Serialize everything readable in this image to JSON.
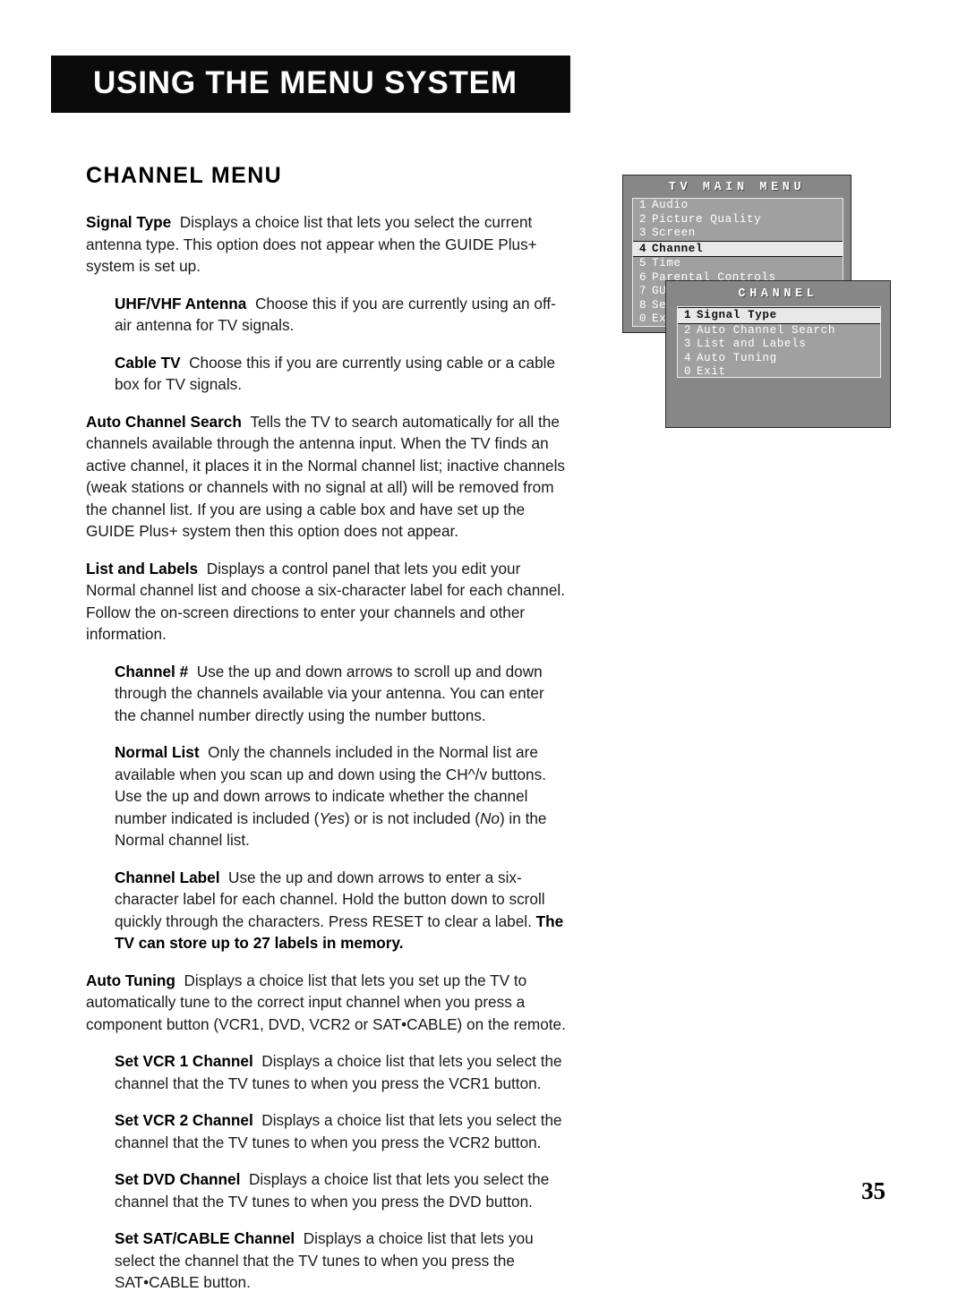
{
  "header": {
    "title": "USING THE MENU SYSTEM"
  },
  "section": {
    "title": "CHANNEL MENU"
  },
  "page_number": "35",
  "body": {
    "paragraphs": [
      {
        "indent": false,
        "term": "Signal Type",
        "text": "Displays a choice list that lets you select the current antenna type. This option does not appear when the GUIDE Plus+ system is set up."
      },
      {
        "indent": true,
        "term": "UHF/VHF Antenna",
        "text": "Choose this if you are currently using an off-air antenna for TV signals."
      },
      {
        "indent": true,
        "term": "Cable TV",
        "text": "Choose this if you are currently using cable or a cable box for TV signals."
      },
      {
        "indent": false,
        "term": "Auto Channel Search",
        "text": "Tells the TV to search automatically for all the channels available through the antenna input. When the TV finds an active channel, it places it in the Normal channel list; inactive channels (weak stations or channels with no signal at all) will be removed from the channel list. If you are using a cable box and have set up the GUIDE Plus+ system then this option does not appear."
      },
      {
        "indent": false,
        "term": "List and Labels",
        "text": "Displays a control panel that lets you edit your Normal channel list and choose a six-character label for each channel. Follow the on-screen directions to enter your channels and other information."
      },
      {
        "indent": true,
        "term": "Channel #",
        "text": "Use the up and down arrows to scroll up and down through the channels available via your antenna. You can enter the channel number directly using the number buttons."
      },
      {
        "indent": true,
        "term": "Normal List",
        "text": "Only the channels included in the Normal list are available when you scan up and down using the CH^/v buttons. Use the up and down arrows to indicate whether the channel number indicated is included (Yes) or is not included (No) in the Normal channel list.",
        "italics": [
          "Yes",
          "No"
        ]
      },
      {
        "indent": true,
        "term": "Channel Label",
        "text": "Use the up and down arrows to enter a six-character label for each channel. Hold the button down to scroll quickly through the characters. Press RESET to clear a label.",
        "bold_tail": "The TV can store up to 27 labels in memory."
      },
      {
        "indent": false,
        "term": "Auto Tuning",
        "text": "Displays a choice list that lets you set up the TV to automatically tune to the correct input channel when you press a component button (VCR1, DVD, VCR2 or SAT•CABLE) on the remote."
      },
      {
        "indent": true,
        "term": "Set VCR 1 Channel",
        "text": "Displays a choice list that lets you select the channel that the TV tunes to when you press the VCR1 button."
      },
      {
        "indent": true,
        "term": "Set VCR 2 Channel",
        "text": "Displays a choice list that lets you select the channel that the TV tunes to when you press the VCR2 button."
      },
      {
        "indent": true,
        "term": "Set DVD Channel",
        "text": "Displays a choice list that lets you select the channel that the TV tunes to when you press the DVD button."
      },
      {
        "indent": true,
        "term": "Set SAT/CABLE Channel",
        "text": "Displays a choice list that lets you select the channel that the TV tunes to when you press the SAT•CABLE button."
      }
    ]
  },
  "osd": {
    "main_menu": {
      "title": "TV MAIN MENU",
      "items": [
        {
          "num": "1",
          "label": "Audio",
          "selected": false
        },
        {
          "num": "2",
          "label": "Picture Quality",
          "selected": false
        },
        {
          "num": "3",
          "label": "Screen",
          "selected": false
        },
        {
          "num": "4",
          "label": "Channel",
          "selected": true
        },
        {
          "num": "5",
          "label": "Time",
          "selected": false
        },
        {
          "num": "6",
          "label": "Parental Controls",
          "selected": false
        },
        {
          "num": "7",
          "label": "GUIDE Plus+",
          "selected": false
        },
        {
          "num": "8",
          "label": "Setup",
          "selected": false
        },
        {
          "num": "0",
          "label": "Exit",
          "selected": false
        }
      ]
    },
    "channel_menu": {
      "title": "CHANNEL",
      "items": [
        {
          "num": "1",
          "label": "Signal Type",
          "selected": true
        },
        {
          "num": "2",
          "label": "Auto Channel Search",
          "selected": false
        },
        {
          "num": "3",
          "label": "List and Labels",
          "selected": false
        },
        {
          "num": "4",
          "label": "Auto Tuning",
          "selected": false
        },
        {
          "num": "0",
          "label": "Exit",
          "selected": false
        }
      ]
    }
  },
  "colors": {
    "header_bar": "#0b0b0b",
    "osd_window": "#878787",
    "osd_list": "#a0a0a0",
    "osd_highlight": "#e8e8e8",
    "text": "#000000"
  }
}
